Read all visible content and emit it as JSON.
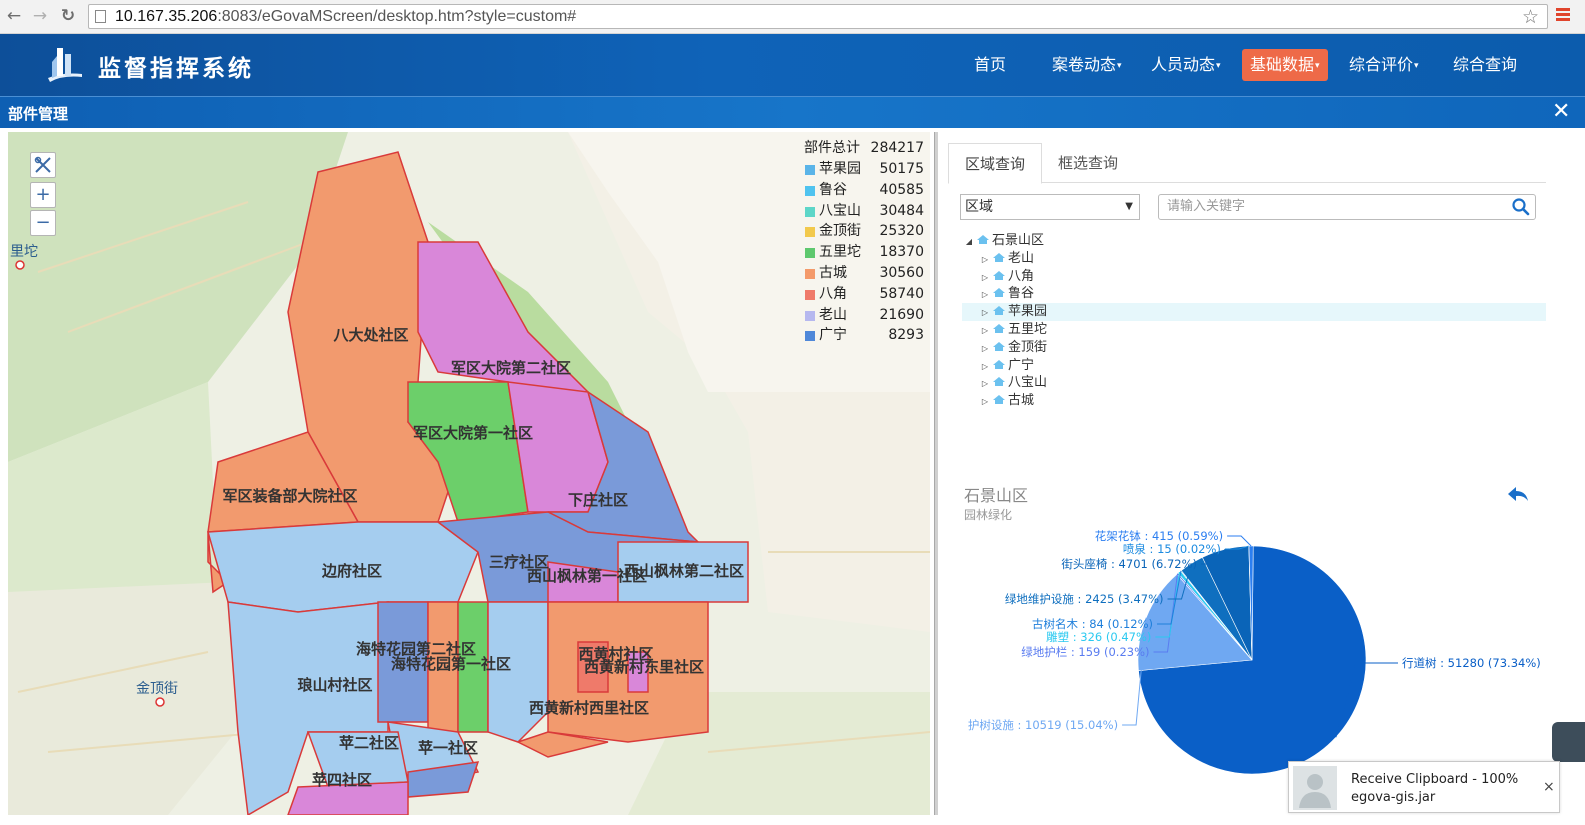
{
  "browser": {
    "url_host": "10.167.35.206",
    "url_rest": ":8083/eGovaMScreen/desktop.htm?style=custom#"
  },
  "app": {
    "title": "监督指挥系统",
    "nav": [
      {
        "label": "首页",
        "dropdown": false,
        "active": false
      },
      {
        "label": "案卷动态",
        "dropdown": true,
        "active": false
      },
      {
        "label": "人员动态",
        "dropdown": true,
        "active": false
      },
      {
        "label": "基础数据",
        "dropdown": true,
        "active": true
      },
      {
        "label": "综合评价",
        "dropdown": true,
        "active": false
      },
      {
        "label": "综合查询",
        "dropdown": false,
        "active": false
      }
    ],
    "accent_color": "#ee6a48",
    "header_color": "#0f63b8"
  },
  "subheader": {
    "title": "部件管理",
    "close": "✕"
  },
  "map": {
    "controls": {
      "zoom_in": "+",
      "zoom_out": "−"
    },
    "legend": {
      "total_label": "部件总计",
      "total_value": "284217",
      "items": [
        {
          "label": "苹果园",
          "value": "50175",
          "color": "#5ab4e8"
        },
        {
          "label": "鲁谷",
          "value": "40585",
          "color": "#4fc3ef"
        },
        {
          "label": "八宝山",
          "value": "30484",
          "color": "#5dd6c8"
        },
        {
          "label": "金顶街",
          "value": "25320",
          "color": "#f2c94c"
        },
        {
          "label": "五里坨",
          "value": "18370",
          "color": "#5ec86e"
        },
        {
          "label": "古城",
          "value": "30560",
          "color": "#f49a6a"
        },
        {
          "label": "八角",
          "value": "58740",
          "color": "#ef7a6a"
        },
        {
          "label": "老山",
          "value": "21690",
          "color": "#b6b8ef"
        },
        {
          "label": "广宁",
          "value": "8293",
          "color": "#4f88d9"
        }
      ]
    },
    "regions": [
      "八大处社区",
      "军区大院第二社区",
      "军区大院第一社区",
      "军区装备部大院社区",
      "下庄社区",
      "边府社区",
      "三疗社区",
      "西山枫林第一社区",
      "西山枫林第二社区",
      "海特花园第二社区",
      "海特花园第一社区",
      "西黄村社区",
      "西黄新村东里社区",
      "琅山村社区",
      "西黄新村西里社区",
      "苹二社区",
      "苹一社区",
      "苹四社区"
    ],
    "places": [
      "里坨",
      "金顶街"
    ]
  },
  "panel": {
    "tabs": [
      {
        "label": "区域查询",
        "active": true
      },
      {
        "label": "框选查询",
        "active": false
      }
    ],
    "select_value": "区域",
    "search_placeholder": "请输入关键字",
    "tree": {
      "root": "石景山区",
      "children": [
        "老山",
        "八角",
        "鲁谷",
        "苹果园",
        "五里坨",
        "金顶街",
        "广宁",
        "八宝山",
        "古城"
      ],
      "highlighted": "苹果园"
    },
    "chart_title": "石景山区",
    "chart_subtitle": "园林绿化"
  },
  "chart_data": {
    "type": "pie",
    "title": "石景山区",
    "subtitle": "园林绿化",
    "slices": [
      {
        "label": "行道树",
        "value": 51280,
        "percent": 73.34,
        "color": "#0a5fc7"
      },
      {
        "label": "护树设施",
        "value": 10519,
        "percent": 15.04,
        "color": "#6fa8f2"
      },
      {
        "label": "绿地护栏",
        "value": 159,
        "percent": 0.23,
        "color": "#5a7cf0"
      },
      {
        "label": "雕塑",
        "value": 326,
        "percent": 0.47,
        "color": "#2bc9f0"
      },
      {
        "label": "古树名木",
        "value": 84,
        "percent": 0.12,
        "color": "#1f7fdb"
      },
      {
        "label": "绿地维护设施",
        "value": 2425,
        "percent": 3.47,
        "color": "#0f6fbf"
      },
      {
        "label": "街头座椅",
        "value": 4701,
        "percent": 6.72,
        "color": "#0a64b8"
      },
      {
        "label": "喷泉",
        "value": 15,
        "percent": 0.02,
        "color": "#1a8ae0"
      },
      {
        "label": "花架花钵",
        "value": 415,
        "percent": 0.59,
        "color": "#2b7ef0"
      }
    ],
    "label_texts": [
      "行道树 : 51280 (73.34%)",
      "护树设施 : 10519 (15.04%)",
      "绿地护栏 : 159 (0.23%)",
      "雕塑 : 326 (0.47%)",
      "古树名木 : 84 (0.12%)",
      "绿地维护设施 : 2425 (3.47%)",
      "街头座椅 : 4701 (6.72%)",
      "喷泉 : 15 (0.02%)",
      "花架花钵 : 415 (0.59%)"
    ]
  },
  "toast": {
    "line1": "Receive Clipboard - 100%",
    "line2": "egova-gis.jar",
    "close": "×"
  }
}
